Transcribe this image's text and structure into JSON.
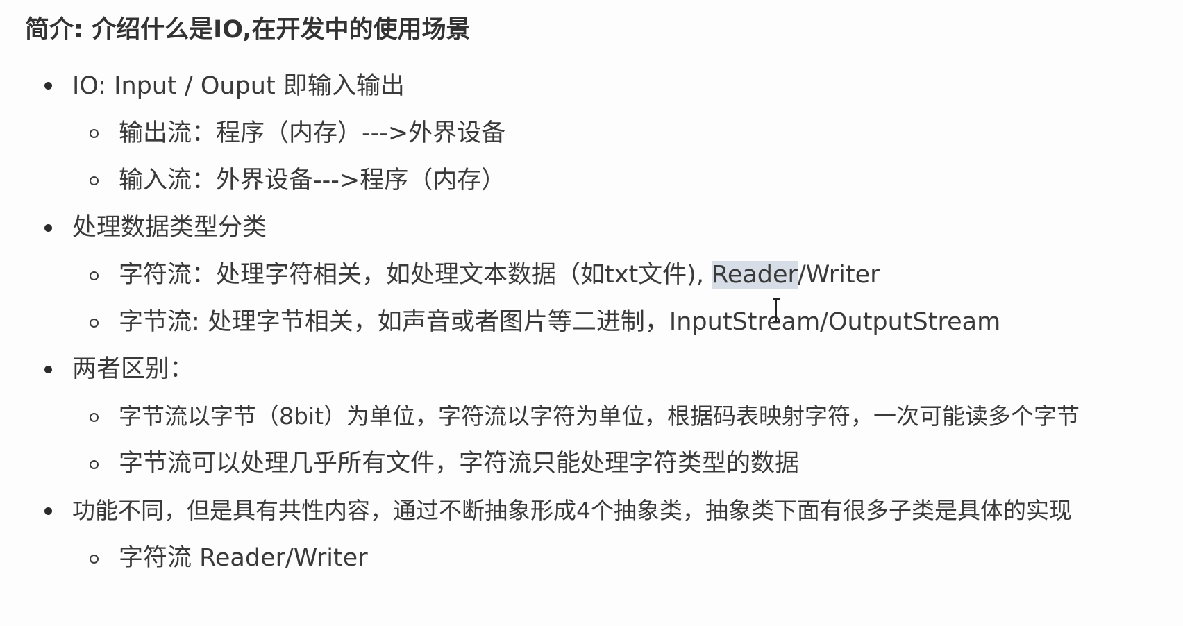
{
  "heading": "简介: 介绍什么是IO,在开发中的使用场景",
  "items": [
    {
      "text": "IO: Input / Ouput 即输入输出"
    },
    {
      "text": "输出流：程序（内存）--->外界设备"
    },
    {
      "text": "输入流：外界设备--->程序（内存）"
    },
    {
      "text": "处理数据类型分类"
    },
    {
      "prefix": "字符流：处理字符相关，如处理文本数据（如txt文件), ",
      "highlight": "Reader",
      "suffix": "/Writer"
    },
    {
      "text": "字节流: 处理字节相关，如声音或者图片等二进制，InputStream/OutputStream"
    },
    {
      "text": "两者区别："
    },
    {
      "text": "字节流以字节（8bit）为单位，字符流以字符为单位，根据码表映射字符，一次可能读多个字节"
    },
    {
      "text": "字节流可以处理几乎所有文件，字符流只能处理字符类型的数据"
    },
    {
      "text": "功能不同，但是具有共性内容，通过不断抽象形成4个抽象类，抽象类下面有很多子类是具体的实现"
    },
    {
      "text": "字符流 Reader/Writer"
    }
  ]
}
